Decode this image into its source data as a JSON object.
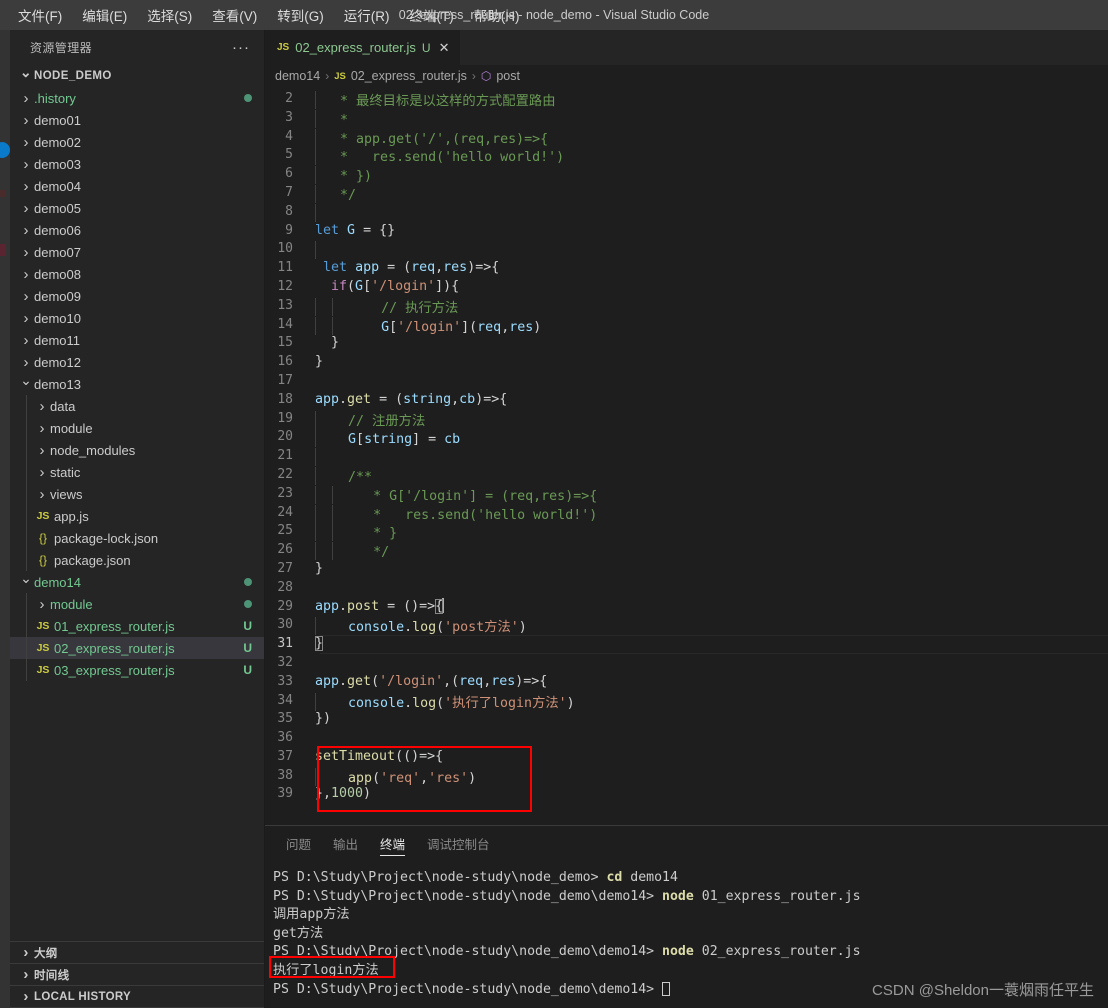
{
  "window": {
    "title": "02_express_router.js - node_demo - Visual Studio Code",
    "menus": [
      "文件(F)",
      "编辑(E)",
      "选择(S)",
      "查看(V)",
      "转到(G)",
      "运行(R)",
      "终端(T)",
      "帮助(H)"
    ]
  },
  "sidebar": {
    "header": "资源管理器",
    "more": "···",
    "root": "NODE_DEMO",
    "items": [
      {
        "label": ".history",
        "type": "folder",
        "indent": 1,
        "state": "closed",
        "green": true,
        "dot": true
      },
      {
        "label": "demo01",
        "type": "folder",
        "indent": 1,
        "state": "closed"
      },
      {
        "label": "demo02",
        "type": "folder",
        "indent": 1,
        "state": "closed"
      },
      {
        "label": "demo03",
        "type": "folder",
        "indent": 1,
        "state": "closed"
      },
      {
        "label": "demo04",
        "type": "folder",
        "indent": 1,
        "state": "closed"
      },
      {
        "label": "demo05",
        "type": "folder",
        "indent": 1,
        "state": "closed"
      },
      {
        "label": "demo06",
        "type": "folder",
        "indent": 1,
        "state": "closed"
      },
      {
        "label": "demo07",
        "type": "folder",
        "indent": 1,
        "state": "closed"
      },
      {
        "label": "demo08",
        "type": "folder",
        "indent": 1,
        "state": "closed"
      },
      {
        "label": "demo09",
        "type": "folder",
        "indent": 1,
        "state": "closed"
      },
      {
        "label": "demo10",
        "type": "folder",
        "indent": 1,
        "state": "closed"
      },
      {
        "label": "demo11",
        "type": "folder",
        "indent": 1,
        "state": "closed"
      },
      {
        "label": "demo12",
        "type": "folder",
        "indent": 1,
        "state": "closed"
      },
      {
        "label": "demo13",
        "type": "folder",
        "indent": 1,
        "state": "open"
      },
      {
        "label": "data",
        "type": "folder",
        "indent": 2,
        "state": "closed"
      },
      {
        "label": "module",
        "type": "folder",
        "indent": 2,
        "state": "closed"
      },
      {
        "label": "node_modules",
        "type": "folder",
        "indent": 2,
        "state": "closed"
      },
      {
        "label": "static",
        "type": "folder",
        "indent": 2,
        "state": "closed"
      },
      {
        "label": "views",
        "type": "folder",
        "indent": 2,
        "state": "closed"
      },
      {
        "label": "app.js",
        "type": "js",
        "indent": 2
      },
      {
        "label": "package-lock.json",
        "type": "json",
        "indent": 2
      },
      {
        "label": "package.json",
        "type": "json",
        "indent": 2
      },
      {
        "label": "demo14",
        "type": "folder",
        "indent": 1,
        "state": "open",
        "green": true,
        "dot": true
      },
      {
        "label": "module",
        "type": "folder",
        "indent": 2,
        "state": "closed",
        "green": true,
        "dot": true
      },
      {
        "label": "01_express_router.js",
        "type": "js",
        "indent": 2,
        "green": true,
        "badge": "U"
      },
      {
        "label": "02_express_router.js",
        "type": "js",
        "indent": 2,
        "green": true,
        "badge": "U",
        "selected": true
      },
      {
        "label": "03_express_router.js",
        "type": "js",
        "indent": 2,
        "green": true,
        "badge": "U"
      }
    ],
    "bottom_sections": [
      "大纲",
      "时间线",
      "LOCAL HISTORY"
    ]
  },
  "editor": {
    "tab": {
      "icon": "JS",
      "name": "02_express_router.js",
      "dirty_badge": "U",
      "close": "✕"
    },
    "breadcrumb": {
      "folder": "demo14",
      "sep": "›",
      "file_icon": "JS",
      "file": "02_express_router.js",
      "symbol_icon": "⬡",
      "symbol": "post"
    },
    "first_line_number": 2,
    "current_line": 31,
    "lines": [
      {
        "n": 2,
        "tokens": [
          {
            "t": " ",
            "c": "pl"
          },
          {
            "t": "* 最终目标是以这样的方式配置路由",
            "c": "com"
          }
        ],
        "guide": 1
      },
      {
        "n": 3,
        "tokens": [
          {
            "t": " ",
            "c": "pl"
          },
          {
            "t": "*",
            "c": "com"
          }
        ],
        "guide": 1
      },
      {
        "n": 4,
        "tokens": [
          {
            "t": " ",
            "c": "pl"
          },
          {
            "t": "* app.get('/',(req,res)=>{",
            "c": "com"
          }
        ],
        "guide": 1
      },
      {
        "n": 5,
        "tokens": [
          {
            "t": " ",
            "c": "pl"
          },
          {
            "t": "*   res.send('hello world!')",
            "c": "com"
          }
        ],
        "guide": 1
      },
      {
        "n": 6,
        "tokens": [
          {
            "t": " ",
            "c": "pl"
          },
          {
            "t": "* })",
            "c": "com"
          }
        ],
        "guide": 1
      },
      {
        "n": 7,
        "tokens": [
          {
            "t": " ",
            "c": "pl"
          },
          {
            "t": "*/",
            "c": "com"
          }
        ],
        "guide": 1
      },
      {
        "n": 8,
        "tokens": [],
        "guide": 1
      },
      {
        "n": 9,
        "tokens": [
          {
            "t": "let",
            "c": "kw"
          },
          {
            "t": " ",
            "c": "pl"
          },
          {
            "t": "G",
            "c": "var"
          },
          {
            "t": " = {}",
            "c": "pl"
          }
        ]
      },
      {
        "n": 10,
        "tokens": [],
        "guide": 1
      },
      {
        "n": 11,
        "tokens": [
          {
            "t": " ",
            "c": "pl"
          },
          {
            "t": "let",
            "c": "kw"
          },
          {
            "t": " ",
            "c": "pl"
          },
          {
            "t": "app",
            "c": "var"
          },
          {
            "t": " = (",
            "c": "pl"
          },
          {
            "t": "req",
            "c": "var"
          },
          {
            "t": ",",
            "c": "pl"
          },
          {
            "t": "res",
            "c": "var"
          },
          {
            "t": ")=>{",
            "c": "pl"
          }
        ]
      },
      {
        "n": 12,
        "tokens": [
          {
            "t": "  ",
            "c": "pl"
          },
          {
            "t": "if",
            "c": "ctl"
          },
          {
            "t": "(",
            "c": "pl"
          },
          {
            "t": "G",
            "c": "var"
          },
          {
            "t": "[",
            "c": "pl"
          },
          {
            "t": "'/login'",
            "c": "str"
          },
          {
            "t": "]){",
            "c": "pl"
          }
        ]
      },
      {
        "n": 13,
        "tokens": [
          {
            "t": "    ",
            "c": "pl"
          },
          {
            "t": "// 执行方法",
            "c": "com"
          }
        ],
        "guide": 2
      },
      {
        "n": 14,
        "tokens": [
          {
            "t": "    ",
            "c": "pl"
          },
          {
            "t": "G",
            "c": "var"
          },
          {
            "t": "[",
            "c": "pl"
          },
          {
            "t": "'/login'",
            "c": "str"
          },
          {
            "t": "](",
            "c": "pl"
          },
          {
            "t": "req",
            "c": "var"
          },
          {
            "t": ",",
            "c": "pl"
          },
          {
            "t": "res",
            "c": "var"
          },
          {
            "t": ")",
            "c": "pl"
          }
        ],
        "guide": 2
      },
      {
        "n": 15,
        "tokens": [
          {
            "t": "  }",
            "c": "pl"
          }
        ]
      },
      {
        "n": 16,
        "tokens": [
          {
            "t": "}",
            "c": "pl"
          }
        ]
      },
      {
        "n": 17,
        "tokens": []
      },
      {
        "n": 18,
        "tokens": [
          {
            "t": "app",
            "c": "var"
          },
          {
            "t": ".",
            "c": "pl"
          },
          {
            "t": "get",
            "c": "fn"
          },
          {
            "t": " = (",
            "c": "pl"
          },
          {
            "t": "string",
            "c": "var"
          },
          {
            "t": ",",
            "c": "pl"
          },
          {
            "t": "cb",
            "c": "var"
          },
          {
            "t": ")=>{",
            "c": "pl"
          }
        ]
      },
      {
        "n": 19,
        "tokens": [
          {
            "t": "  ",
            "c": "pl"
          },
          {
            "t": "// 注册方法",
            "c": "com"
          }
        ],
        "guide": 1
      },
      {
        "n": 20,
        "tokens": [
          {
            "t": "  ",
            "c": "pl"
          },
          {
            "t": "G",
            "c": "var"
          },
          {
            "t": "[",
            "c": "pl"
          },
          {
            "t": "string",
            "c": "var"
          },
          {
            "t": "] = ",
            "c": "pl"
          },
          {
            "t": "cb",
            "c": "var"
          }
        ],
        "guide": 1
      },
      {
        "n": 21,
        "tokens": [],
        "guide": 1
      },
      {
        "n": 22,
        "tokens": [
          {
            "t": "  ",
            "c": "pl"
          },
          {
            "t": "/**",
            "c": "com"
          }
        ],
        "guide": 1
      },
      {
        "n": 23,
        "tokens": [
          {
            "t": "   ",
            "c": "pl"
          },
          {
            "t": "* G['/login'] = (req,res)=>{",
            "c": "com"
          }
        ],
        "guide": 2
      },
      {
        "n": 24,
        "tokens": [
          {
            "t": "   ",
            "c": "pl"
          },
          {
            "t": "*   res.send('hello world!')",
            "c": "com"
          }
        ],
        "guide": 2
      },
      {
        "n": 25,
        "tokens": [
          {
            "t": "   ",
            "c": "pl"
          },
          {
            "t": "* }",
            "c": "com"
          }
        ],
        "guide": 2
      },
      {
        "n": 26,
        "tokens": [
          {
            "t": "   ",
            "c": "pl"
          },
          {
            "t": "*/",
            "c": "com"
          }
        ],
        "guide": 2
      },
      {
        "n": 27,
        "tokens": [
          {
            "t": "}",
            "c": "pl"
          }
        ]
      },
      {
        "n": 28,
        "tokens": []
      },
      {
        "n": 29,
        "tokens": [
          {
            "t": "app",
            "c": "var"
          },
          {
            "t": ".",
            "c": "pl"
          },
          {
            "t": "post",
            "c": "fn"
          },
          {
            "t": " = ()=>",
            "c": "pl"
          },
          {
            "t": "{",
            "c": "pl",
            "bracket": true,
            "cursor": true
          }
        ]
      },
      {
        "n": 30,
        "tokens": [
          {
            "t": "  ",
            "c": "pl"
          },
          {
            "t": "console",
            "c": "var"
          },
          {
            "t": ".",
            "c": "pl"
          },
          {
            "t": "log",
            "c": "fn"
          },
          {
            "t": "(",
            "c": "pl"
          },
          {
            "t": "'post方法'",
            "c": "str"
          },
          {
            "t": ")",
            "c": "pl"
          }
        ],
        "guide": 1
      },
      {
        "n": 31,
        "tokens": [
          {
            "t": "}",
            "c": "pl",
            "bracket": true
          }
        ]
      },
      {
        "n": 32,
        "tokens": []
      },
      {
        "n": 33,
        "tokens": [
          {
            "t": "app",
            "c": "var"
          },
          {
            "t": ".",
            "c": "pl"
          },
          {
            "t": "get",
            "c": "fn"
          },
          {
            "t": "(",
            "c": "pl"
          },
          {
            "t": "'/login'",
            "c": "str"
          },
          {
            "t": ",(",
            "c": "pl"
          },
          {
            "t": "req",
            "c": "var"
          },
          {
            "t": ",",
            "c": "pl"
          },
          {
            "t": "res",
            "c": "var"
          },
          {
            "t": ")=>{",
            "c": "pl"
          }
        ]
      },
      {
        "n": 34,
        "tokens": [
          {
            "t": "  ",
            "c": "pl"
          },
          {
            "t": "console",
            "c": "var"
          },
          {
            "t": ".",
            "c": "pl"
          },
          {
            "t": "log",
            "c": "fn"
          },
          {
            "t": "(",
            "c": "pl"
          },
          {
            "t": "'执行了login方法'",
            "c": "str"
          },
          {
            "t": ")",
            "c": "pl"
          }
        ],
        "guide": 1
      },
      {
        "n": 35,
        "tokens": [
          {
            "t": "})",
            "c": "pl"
          }
        ]
      },
      {
        "n": 36,
        "tokens": []
      },
      {
        "n": 37,
        "tokens": [
          {
            "t": "setTimeout",
            "c": "fn"
          },
          {
            "t": "(()=>{",
            "c": "pl"
          }
        ]
      },
      {
        "n": 38,
        "tokens": [
          {
            "t": "  ",
            "c": "pl"
          },
          {
            "t": "app",
            "c": "fn"
          },
          {
            "t": "(",
            "c": "pl"
          },
          {
            "t": "'req'",
            "c": "str"
          },
          {
            "t": ",",
            "c": "pl"
          },
          {
            "t": "'res'",
            "c": "str"
          },
          {
            "t": ")",
            "c": "pl"
          }
        ],
        "guide": 1
      },
      {
        "n": 39,
        "tokens": [
          {
            "t": "},",
            "c": "pl"
          },
          {
            "t": "1000",
            "c": "num"
          },
          {
            "t": ")",
            "c": "pl"
          }
        ]
      }
    ],
    "annotation_boxes": [
      {
        "name": "setTimeout-highlight",
        "color": "#ff0000",
        "lines": "37-39"
      }
    ]
  },
  "panel": {
    "tabs": [
      {
        "label": "问题",
        "active": false
      },
      {
        "label": "输出",
        "active": false
      },
      {
        "label": "终端",
        "active": true
      },
      {
        "label": "调试控制台",
        "active": false
      }
    ],
    "terminal_lines": [
      [
        {
          "t": "PS D:\\Study\\Project\\node-study\\node_demo> ",
          "c": "out"
        },
        {
          "t": "cd",
          "c": "cmd"
        },
        {
          "t": " demo14",
          "c": "out"
        }
      ],
      [
        {
          "t": "PS D:\\Study\\Project\\node-study\\node_demo\\demo14> ",
          "c": "out"
        },
        {
          "t": "node",
          "c": "cmd"
        },
        {
          "t": " 01_express_router.js",
          "c": "out"
        }
      ],
      [
        {
          "t": "调用app方法",
          "c": "out"
        }
      ],
      [
        {
          "t": "get方法",
          "c": "out"
        }
      ],
      [
        {
          "t": "PS D:\\Study\\Project\\node-study\\node_demo\\demo14> ",
          "c": "out"
        },
        {
          "t": "node",
          "c": "cmd"
        },
        {
          "t": " 02_express_router.js",
          "c": "out"
        }
      ],
      [
        {
          "t": "执行了login方法",
          "c": "out"
        }
      ],
      [
        {
          "t": "PS D:\\Study\\Project\\node-study\\node_demo\\demo14> ",
          "c": "out"
        },
        {
          "t": "__CURSOR__",
          "c": "cursor"
        }
      ]
    ],
    "annotation_boxes": [
      {
        "name": "login-output-highlight",
        "color": "#ff0000",
        "line": "执行了login方法"
      }
    ]
  },
  "watermark": "CSDN @Sheldon一蓑烟雨任平生"
}
